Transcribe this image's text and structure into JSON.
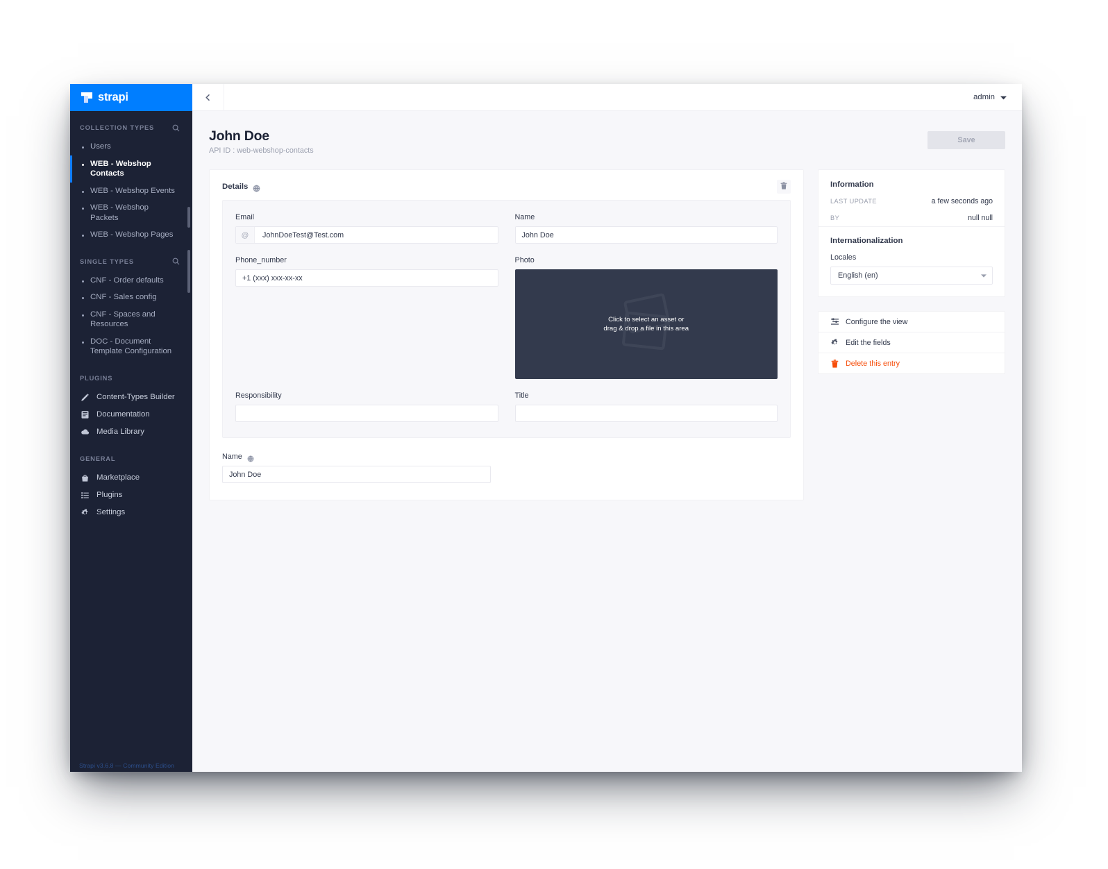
{
  "brand": {
    "name": "strapi",
    "logo_icon": "strapi-logo-icon"
  },
  "sidebar": {
    "sections": [
      {
        "label": "COLLECTION TYPES",
        "search_icon": "search-icon",
        "items": [
          {
            "label": "Users",
            "active": false
          },
          {
            "label": "WEB - Webshop Contacts",
            "active": true
          },
          {
            "label": "WEB - Webshop Events",
            "active": false
          },
          {
            "label": "WEB - Webshop Packets",
            "active": false
          },
          {
            "label": "WEB - Webshop Pages",
            "active": false
          }
        ]
      },
      {
        "label": "SINGLE TYPES",
        "search_icon": "search-icon",
        "items": [
          {
            "label": "CNF - Order defaults",
            "active": false
          },
          {
            "label": "CNF - Sales config",
            "active": false
          },
          {
            "label": "CNF - Spaces and Resources",
            "active": false
          },
          {
            "label": "DOC - Document Template Configuration",
            "active": false
          }
        ]
      }
    ],
    "plugins": {
      "label": "PLUGINS",
      "items": [
        {
          "label": "Content-Types Builder",
          "icon": "pencil-icon"
        },
        {
          "label": "Documentation",
          "icon": "book-icon"
        },
        {
          "label": "Media Library",
          "icon": "cloud-icon"
        }
      ]
    },
    "general": {
      "label": "GENERAL",
      "items": [
        {
          "label": "Marketplace",
          "icon": "shopping-bag-icon"
        },
        {
          "label": "Plugins",
          "icon": "list-icon"
        },
        {
          "label": "Settings",
          "icon": "gear-icon"
        }
      ]
    },
    "footer": "Strapi v3.6.8 — Community Edition"
  },
  "topbar": {
    "back_icon": "chevron-left-icon",
    "admin_label": "admin",
    "admin_caret_icon": "chevron-down-icon"
  },
  "page": {
    "title": "John Doe",
    "api_id_label": "API ID : web-webshop-contacts",
    "save_label": "Save"
  },
  "component": {
    "title": "Details",
    "i18n_icon": "globe-icon",
    "delete_icon": "trash-icon",
    "fields": {
      "email": {
        "label": "Email",
        "prefix": "@",
        "value": "JohnDoeTest@Test.com",
        "placeholder": "JohnDoeTest@Test.com"
      },
      "name": {
        "label": "Name",
        "value": "John Doe",
        "placeholder": "John Doe"
      },
      "phone_number": {
        "label": "Phone_number",
        "value": "+1 (xxx) xxx-xx-xx",
        "placeholder": "+1 (xxx) xxx-xx-xx"
      },
      "photo": {
        "label": "Photo",
        "dropzone_line1": "Click to select an asset or",
        "dropzone_line2": "drag & drop a file in this area",
        "dropzone_icon": "image-stack-icon"
      },
      "responsibility": {
        "label": "Responsibility",
        "value": "",
        "placeholder": ""
      },
      "title": {
        "label": "Title",
        "value": "",
        "placeholder": ""
      }
    }
  },
  "outer_field": {
    "label": "Name",
    "i18n_icon": "globe-icon",
    "value": "John Doe",
    "placeholder": "John Doe"
  },
  "information": {
    "title": "Information",
    "rows": [
      {
        "key": "LAST UPDATE",
        "value": "a few seconds ago"
      },
      {
        "key": "BY",
        "value": "null null"
      }
    ],
    "i18n_title": "Internationalization",
    "locales_label": "Locales",
    "locale_value": "English (en)",
    "locale_caret_icon": "chevron-down-icon"
  },
  "actions": [
    {
      "label": "Configure the view",
      "icon": "layout-icon",
      "danger": false
    },
    {
      "label": "Edit the fields",
      "icon": "gear-icon",
      "danger": false
    },
    {
      "label": "Delete this entry",
      "icon": "trash-icon",
      "danger": true
    }
  ],
  "colors": {
    "brand_blue": "#007eff",
    "sidebar_bg": "#1c2235",
    "danger": "#f64d0a",
    "dropzone_bg": "#333a4d"
  }
}
